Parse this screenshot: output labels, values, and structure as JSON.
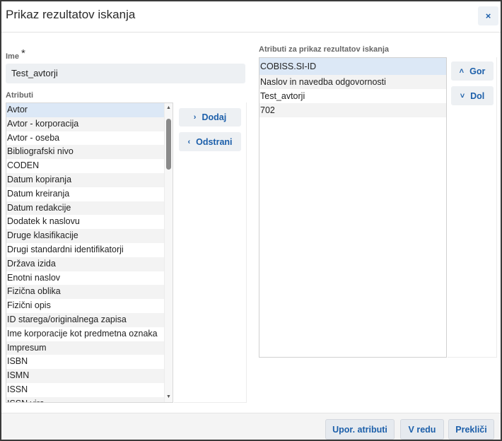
{
  "dialog": {
    "title": "Prikaz rezultatov iskanja",
    "close_label": "×"
  },
  "name": {
    "label": "Ime",
    "required_mark": "*",
    "value": "Test_avtorji"
  },
  "attributes": {
    "label": "Atributi",
    "selected": "Avtor",
    "items": [
      "Avtor",
      "Avtor - korporacija",
      "Avtor - oseba",
      "Bibliografski nivo",
      "CODEN",
      "Datum kopiranja",
      "Datum kreiranja",
      "Datum redakcije",
      "Dodatek k naslovu",
      "Druge klasifikacije",
      "Drugi standardni identifikatorji",
      "Država izida",
      "Enotni naslov",
      "Fizična oblika",
      "Fizični opis",
      "ID starega/originalnega zapisa",
      "Ime korporacije kot predmetna oznaka",
      "Impresum",
      "ISBN",
      "ISMN",
      "ISSN",
      "ISSN vira"
    ]
  },
  "transfer": {
    "add_label": "Dodaj",
    "remove_label": "Odstrani",
    "add_icon": "chevron-right-icon",
    "remove_icon": "chevron-left-icon"
  },
  "results": {
    "label": "Atributi za prikaz rezultatov iskanja",
    "selected": "COBISS.SI-ID",
    "items": [
      "COBISS.SI-ID",
      "Naslov in navedba odgovornosti",
      "Test_avtorji",
      "702"
    ]
  },
  "ordering": {
    "up_label": "Gor",
    "down_label": "Dol",
    "up_icon": "chevron-up-icon",
    "down_icon": "chevron-down-icon"
  },
  "footer": {
    "user_attributes_label": "Upor. atributi",
    "ok_label": "V redu",
    "cancel_label": "Prekliči"
  },
  "colors": {
    "accent": "#1c5faa",
    "selection": "#dce8f6",
    "button_bg": "#edf0f3"
  }
}
